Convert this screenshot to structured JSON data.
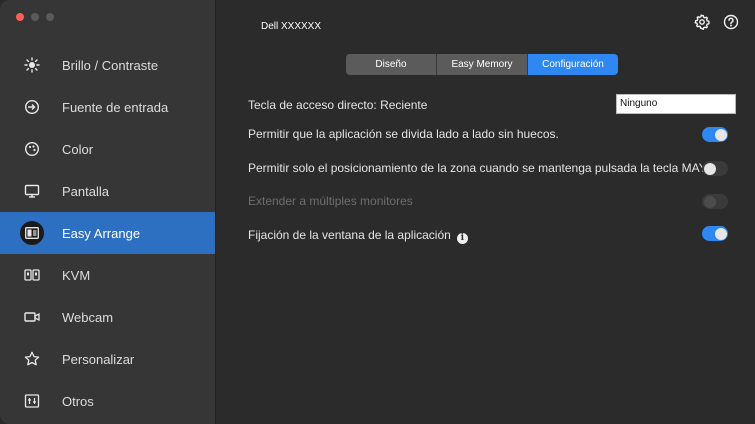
{
  "window": {
    "title": "Dell XXXXXX"
  },
  "traffic_lights": {
    "close_color": "#ff5f57",
    "inactive_color": "#5a5a5a"
  },
  "sidebar": {
    "items": [
      {
        "label": "Brillo / Contraste",
        "icon": "brightness-icon"
      },
      {
        "label": "Fuente de entrada",
        "icon": "input-source-icon"
      },
      {
        "label": "Color",
        "icon": "color-palette-icon"
      },
      {
        "label": "Pantalla",
        "icon": "monitor-icon"
      },
      {
        "label": "Easy Arrange",
        "icon": "easy-arrange-icon",
        "active": true
      },
      {
        "label": "KVM",
        "icon": "kvm-icon"
      },
      {
        "label": "Webcam",
        "icon": "webcam-icon"
      },
      {
        "label": "Personalizar",
        "icon": "star-icon"
      },
      {
        "label": "Otros",
        "icon": "others-icon"
      }
    ]
  },
  "header": {
    "settings_icon": "gear-icon",
    "help_icon": "help-icon"
  },
  "tabs": [
    {
      "label": "Diseño"
    },
    {
      "label": "Easy Memory"
    },
    {
      "label": "Configuración",
      "active": true
    }
  ],
  "settings": {
    "hotkey_label": "Tecla de acceso directo: Reciente",
    "hotkey_value": "Ninguno",
    "snap_label": "Permitir que la aplicación se divida lado a lado sin huecos.",
    "snap_on": true,
    "shift_label": "Permitir solo el posicionamiento de la zona cuando se mantenga pulsada la tecla MAYÚS",
    "shift_on": false,
    "extend_label": "Extender a múltiples monitores",
    "extend_enabled": false,
    "pin_label": "Fijación de la ventana de la aplicación",
    "pin_on": true
  },
  "colors": {
    "accent": "#2f88f2",
    "sidebar_active": "#2d6fc0"
  }
}
